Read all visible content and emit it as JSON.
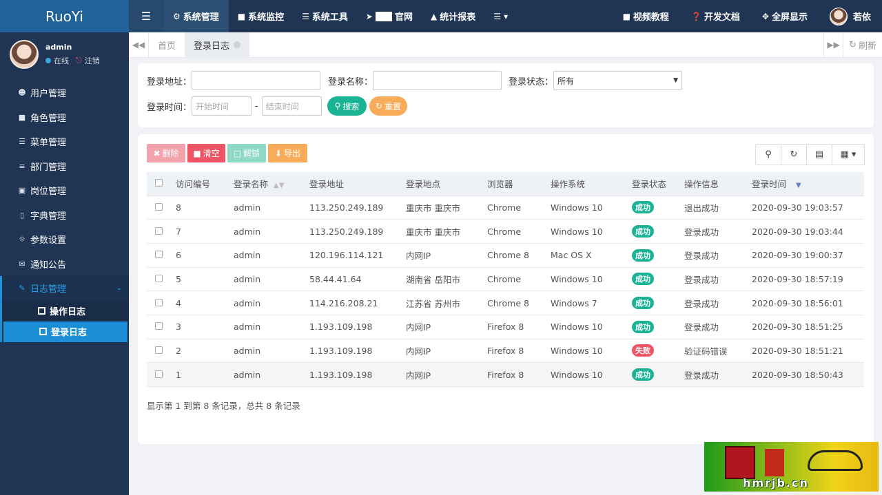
{
  "app": {
    "logo": "RuoYi"
  },
  "user": {
    "name": "admin",
    "status": "在线",
    "logout": "注销",
    "top_name": "若依"
  },
  "sidebar": {
    "items": [
      {
        "label": "用户管理",
        "icon": "user-icon"
      },
      {
        "label": "角色管理",
        "icon": "lock-icon"
      },
      {
        "label": "菜单管理",
        "icon": "list-icon"
      },
      {
        "label": "部门管理",
        "icon": "outdent-icon"
      },
      {
        "label": "岗位管理",
        "icon": "address-card-icon"
      },
      {
        "label": "字典管理",
        "icon": "bookmark-icon"
      },
      {
        "label": "参数设置",
        "icon": "sun-icon"
      },
      {
        "label": "通知公告",
        "icon": "bullhorn-icon"
      },
      {
        "label": "日志管理",
        "icon": "edit-icon"
      }
    ],
    "sub_items": [
      {
        "label": "操作日志"
      },
      {
        "label": "登录日志"
      }
    ]
  },
  "topnav": {
    "items": [
      "系统管理",
      "系统监控",
      "系统工具",
      "官网",
      "统计报表"
    ],
    "right": [
      "视频教程",
      "开发文档",
      "全屏显示"
    ]
  },
  "tabs": {
    "home": "首页",
    "active": "登录日志",
    "refresh": "刷新"
  },
  "search": {
    "addr_label": "登录地址：",
    "name_label": "登录名称：",
    "status_label": "登录状态：",
    "status_value": "所有",
    "time_label": "登录时间：",
    "start_placeholder": "开始时间",
    "end_placeholder": "结束时间",
    "sep": "-",
    "search_btn": "搜索",
    "reset_btn": "重置"
  },
  "toolbar": {
    "delete": "删除",
    "clear": "清空",
    "unlock": "解锁",
    "export": "导出"
  },
  "colors": {
    "success": "#1ab394",
    "fail": "#ed5565",
    "accent": "#1c8ed6",
    "sidebar": "#1f3553"
  },
  "table": {
    "headers": [
      "访问编号",
      "登录名称",
      "登录地址",
      "登录地点",
      "浏览器",
      "操作系统",
      "登录状态",
      "操作信息",
      "登录时间"
    ],
    "rows": [
      {
        "id": "8",
        "name": "admin",
        "addr": "113.250.249.189",
        "loc": "重庆市 重庆市",
        "browser": "Chrome",
        "os": "Windows 10",
        "status": "成功",
        "msg": "退出成功",
        "time": "2020-09-30 19:03:57"
      },
      {
        "id": "7",
        "name": "admin",
        "addr": "113.250.249.189",
        "loc": "重庆市 重庆市",
        "browser": "Chrome",
        "os": "Windows 10",
        "status": "成功",
        "msg": "登录成功",
        "time": "2020-09-30 19:03:44"
      },
      {
        "id": "6",
        "name": "admin",
        "addr": "120.196.114.121",
        "loc": "内网IP",
        "browser": "Chrome 8",
        "os": "Mac OS X",
        "status": "成功",
        "msg": "登录成功",
        "time": "2020-09-30 19:00:37"
      },
      {
        "id": "5",
        "name": "admin",
        "addr": "58.44.41.64",
        "loc": "湖南省 岳阳市",
        "browser": "Chrome",
        "os": "Windows 10",
        "status": "成功",
        "msg": "登录成功",
        "time": "2020-09-30 18:57:19"
      },
      {
        "id": "4",
        "name": "admin",
        "addr": "114.216.208.21",
        "loc": "江苏省 苏州市",
        "browser": "Chrome 8",
        "os": "Windows 7",
        "status": "成功",
        "msg": "登录成功",
        "time": "2020-09-30 18:56:01"
      },
      {
        "id": "3",
        "name": "admin",
        "addr": "1.193.109.198",
        "loc": "内网IP",
        "browser": "Firefox 8",
        "os": "Windows 10",
        "status": "成功",
        "msg": "登录成功",
        "time": "2020-09-30 18:51:25"
      },
      {
        "id": "2",
        "name": "admin",
        "addr": "1.193.109.198",
        "loc": "内网IP",
        "browser": "Firefox 8",
        "os": "Windows 10",
        "status": "失败",
        "msg": "验证码错误",
        "time": "2020-09-30 18:51:21"
      },
      {
        "id": "1",
        "name": "admin",
        "addr": "1.193.109.198",
        "loc": "内网IP",
        "browser": "Firefox 8",
        "os": "Windows 10",
        "status": "成功",
        "msg": "登录成功",
        "time": "2020-09-30 18:50:43"
      }
    ],
    "footer": "显示第 1 到第 8 条记录，总共 8 条记录"
  },
  "watermark": {
    "text": "hmrjb.cn"
  }
}
